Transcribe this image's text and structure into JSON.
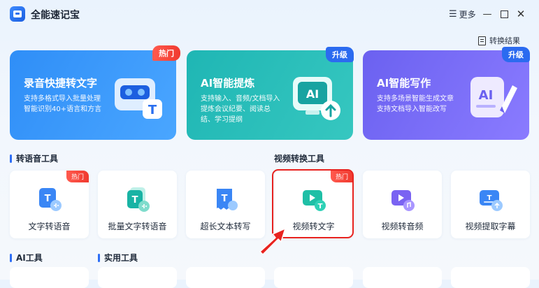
{
  "app": {
    "title": "全能速记宝"
  },
  "titlebar": {
    "more_label": "更多",
    "more_icon": "hamburger-icon",
    "minimize": "—",
    "close": "✕"
  },
  "header": {
    "result_label": "转换结果"
  },
  "banners": [
    {
      "title": "录音快捷转文字",
      "desc": "支持多格式导入批量处理智能识别40+语言和方言",
      "badge": "热门",
      "icon": "cassette-text-icon"
    },
    {
      "title": "AI智能提炼",
      "desc": "支持输入、音频/文档导入提炼会议纪要、阅读总结、学习提纲",
      "badge": "升级",
      "icon": "ai-screen-icon"
    },
    {
      "title": "AI智能写作",
      "desc": "支持多场景智能生成文章支持文档导入智能改写",
      "badge": "升级",
      "icon": "ai-writing-icon"
    }
  ],
  "sections": {
    "speech_tools": "转语音工具",
    "video_tools": "视频转换工具",
    "ai_tools": "AI工具",
    "utility_tools": "实用工具"
  },
  "tools": [
    {
      "label": "文字转语音",
      "badge": "热门"
    },
    {
      "label": "批量文字转语音"
    },
    {
      "label": "超长文本转写"
    },
    {
      "label": "视频转文字",
      "badge": "热门"
    },
    {
      "label": "视频转音频"
    },
    {
      "label": "视频提取字幕"
    }
  ],
  "colors": {
    "accent": "#2d6ef5",
    "hot": "#f03a2f",
    "highlight": "#e8231f"
  }
}
